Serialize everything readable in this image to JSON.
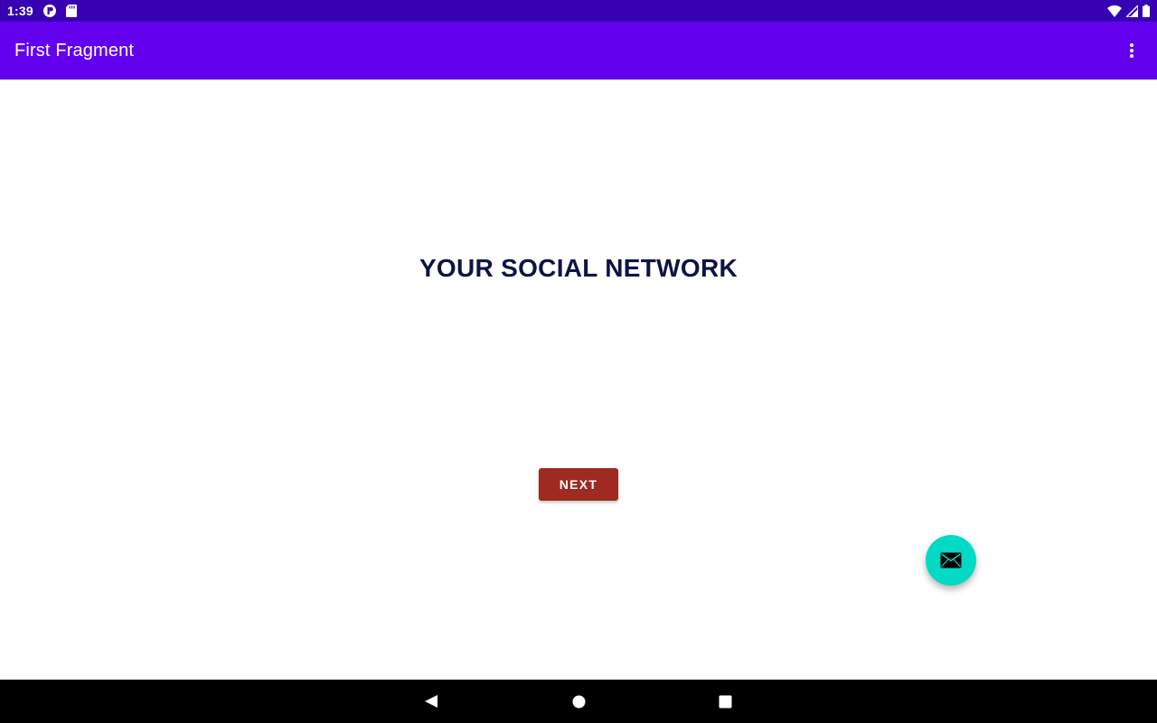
{
  "status_bar": {
    "time": "1:39",
    "left_icons": [
      "notification-app-icon",
      "sd-card-icon"
    ],
    "right_icons": [
      "wifi-icon",
      "cellular-signal-icon",
      "battery-icon"
    ]
  },
  "app_bar": {
    "title": "First Fragment",
    "overflow_icon": "more-vert-icon"
  },
  "main": {
    "heading": "YOUR SOCIAL NETWORK",
    "next_button_label": "NEXT"
  },
  "fab": {
    "icon": "email-icon"
  },
  "nav_bar": {
    "buttons": [
      "back-icon",
      "home-icon",
      "recents-icon"
    ]
  },
  "colors": {
    "status_bar": "#3700b3",
    "app_bar": "#6200ee",
    "heading_text": "#0d1445",
    "next_button": "#9e2a22",
    "fab": "#03dac5",
    "nav_bar": "#000000"
  }
}
